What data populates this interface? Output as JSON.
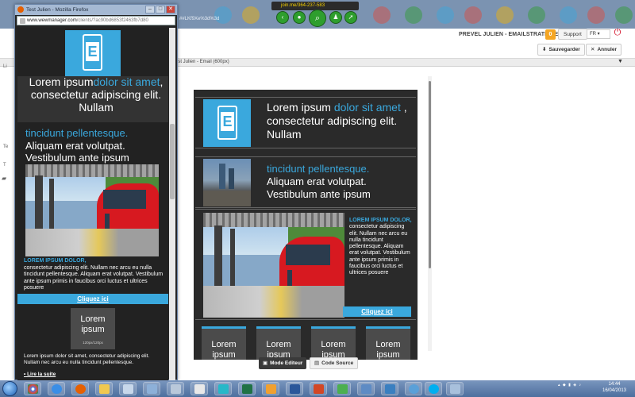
{
  "topbar": {
    "join_link": "join.me/364-237-583",
    "url_fragment": "##LKf9Xe%3d%3d"
  },
  "header": {
    "user_name": "PREVEL JULIEN - EMAILSTRATEGIE",
    "badge_count": "0",
    "support_label": "Support",
    "language": "FR",
    "save_label": "Sauvegarder",
    "cancel_label": "Annuler",
    "tab_title": "Test Julien - Email (600px)"
  },
  "popup": {
    "window_title": "Test Julien - Mozilla Firefox",
    "url_host": "www.wewmanager.com",
    "url_path": "/clients/?ac90bd6853f2463fb7d80",
    "hero_text": {
      "part1": "Lorem ipsum",
      "highlight": "dolor sit amet",
      "part2": ", consectetur adipiscing elit. Nullam"
    },
    "section_text": {
      "highlight": "tincidunt pellentesque.",
      "rest": "Aliquam erat volutpat. Vestibulum ante ipsum"
    },
    "caption_title": "LOREM IPSUM DOLOR,",
    "caption_body": "consectetur adipiscing elit. Nullam nec arcu eu nulla tincidunt pellentesque. Aliquam erat volutpat. Vestibulum ante ipsum primis in faucibus orci luctus et ultrices posuere",
    "cta_label": "Cliquez ici",
    "card_title": "Lorem ipsum",
    "card_size": "120px/120px",
    "footer_text": "Lorem ipsum dolor sit amet, consectetur adipiscing elit. Nullam nec arcu eu nulla tincidunt pellentesque.",
    "more_link": "• Lire la suite"
  },
  "canvas": {
    "hero_text": {
      "part1": "Lorem ipsum ",
      "highlight": "dolor sit amet",
      "part2": " , consectetur adipiscing elit. Nullam"
    },
    "section_text": {
      "highlight": "tincidunt pellentesque.",
      "rest": "Aliquam erat volutpat. Vestibulum ante ipsum"
    },
    "caption_title": "LOREM IPSUM DOLOR,",
    "caption_body": "consectetur adipiscing elit. Nullam nec arcu eu nulla tincidunt pellentesque. Aliquam erat volutpat. Vestibulum ante ipsum primis in faucibus orci luctus et ultrices posuere",
    "cta_label": "Cliquez ici",
    "columns": [
      {
        "label": "Lorem ipsum"
      },
      {
        "label": "Lorem ipsum"
      },
      {
        "label": "Lorem ipsum"
      },
      {
        "label": "Lorem ipsum"
      }
    ],
    "logo_letter": "E"
  },
  "modes": {
    "editor_label": "Mode Editeur",
    "source_label": "Code Source"
  },
  "taskbar": {
    "time": "14:44",
    "date": "16/04/2013"
  },
  "colors": {
    "accent": "#3aa8dd",
    "dark_bg": "#2a2a2a",
    "tram_red": "#d71920"
  }
}
